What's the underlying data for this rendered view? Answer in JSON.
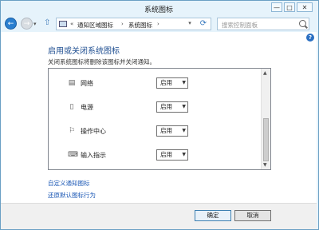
{
  "window": {
    "title": "系统图标",
    "min_glyph": "—",
    "max_glyph": "□",
    "close_glyph": "✕"
  },
  "nav": {
    "address_parts": [
      "通知区域图标",
      "系统图标"
    ],
    "address_prefix": "«",
    "separator": "›",
    "search_placeholder": "搜索控制面板"
  },
  "main": {
    "title": "启用或关闭系统图标",
    "description": "关闭系统图标将删除该图标并关闭通知。",
    "rows": [
      {
        "label": "网络",
        "value": "启用",
        "icon": "network-icon"
      },
      {
        "label": "电源",
        "value": "启用",
        "icon": "power-icon"
      },
      {
        "label": "操作中心",
        "value": "启用",
        "icon": "action-center-flag-icon"
      },
      {
        "label": "输入指示",
        "value": "启用",
        "icon": "input-indicator-icon"
      }
    ],
    "links": {
      "customize": "自定义通知图标",
      "restore": "还原默认图标行为"
    }
  },
  "footer": {
    "ok": "确定",
    "cancel": "取消"
  },
  "colors": {
    "title_blue": "#1e4e91",
    "link_blue": "#1a57b5",
    "frame": "#e6f3fb"
  }
}
